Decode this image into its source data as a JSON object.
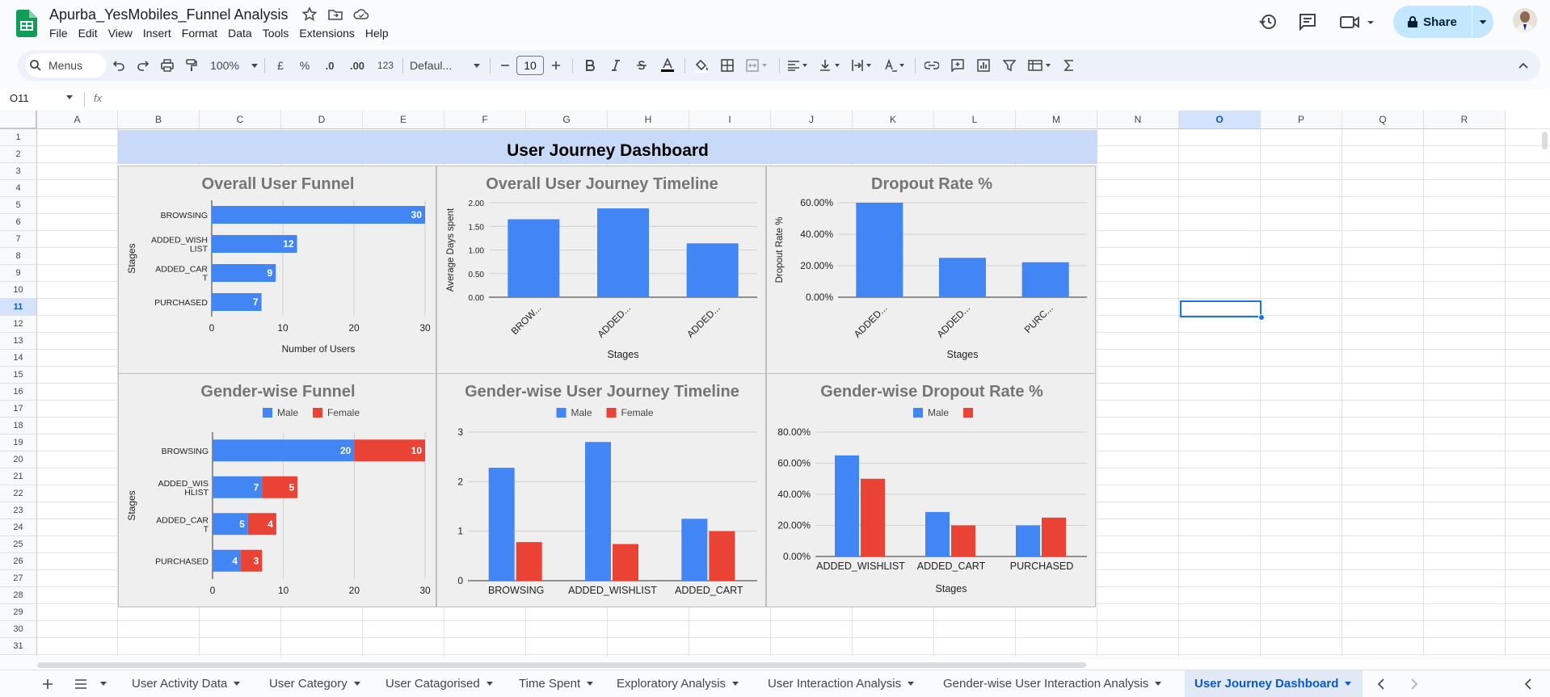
{
  "doc_title": "Apurba_YesMobiles_Funnel Analysis",
  "menu": [
    "File",
    "Edit",
    "View",
    "Insert",
    "Format",
    "Data",
    "Tools",
    "Extensions",
    "Help"
  ],
  "share_label": "Share",
  "toolbar": {
    "search_label": "Menus",
    "zoom": "100%",
    "currency": "£",
    "percent": "%",
    "decrease_decimal": ".0",
    "increase_decimal": ".00",
    "number_format": "123",
    "font": "Defaul...",
    "font_size": "10",
    "accent_color": "#0b57d0"
  },
  "name_box": "O11",
  "fx_label": "fx",
  "columns": [
    "A",
    "B",
    "C",
    "D",
    "E",
    "F",
    "G",
    "H",
    "I",
    "J",
    "K",
    "L",
    "M",
    "N",
    "O",
    "P",
    "Q",
    "R"
  ],
  "rows": [
    "1",
    "2",
    "3",
    "4",
    "5",
    "6",
    "7",
    "8",
    "9",
    "10",
    "11",
    "12",
    "13",
    "14",
    "15",
    "16",
    "17",
    "18",
    "19",
    "20",
    "21",
    "22",
    "23",
    "24",
    "25",
    "26",
    "27",
    "28",
    "29",
    "30",
    "31"
  ],
  "selected_col": "O",
  "selected_row": "11",
  "dashboard_title": "User Journey Dashboard",
  "tabs": [
    "User Activity Data",
    "User Category",
    "User Catagorised",
    "Time Spent",
    "Exploratory Analysis",
    "User Interaction Analysis",
    "Gender-wise User Interaction Analysis",
    "User Journey Dashboard"
  ],
  "active_tab": "User Journey Dashboard",
  "colors": {
    "blue": "#4285f4",
    "red": "#ea4335",
    "title_gray": "#757575",
    "chart_bg": "#efefef",
    "header_band": "#c9daf8"
  },
  "chart_data": [
    {
      "type": "bar",
      "orientation": "horizontal",
      "title": "Overall User Funnel",
      "xlabel": "Number of Users",
      "ylabel": "Stages",
      "categories": [
        "BROWSING",
        "ADDED_WISH LIST",
        "ADDED_CAR T",
        "PURCHASED"
      ],
      "values": [
        30,
        12,
        9,
        7
      ],
      "xticks": [
        "0",
        "10",
        "20",
        "30"
      ],
      "xlim": [
        0,
        30
      ]
    },
    {
      "type": "bar",
      "title": "Overall User Journey Timeline",
      "xlabel": "Stages",
      "ylabel": "Average Days spent",
      "categories": [
        "BROW...",
        "ADDED...",
        "ADDED..."
      ],
      "values": [
        1.65,
        1.88,
        1.14
      ],
      "yticks": [
        "0.00",
        "0.50",
        "1.00",
        "1.50",
        "2.00"
      ],
      "ylim": [
        0,
        2
      ]
    },
    {
      "type": "bar",
      "title": "Dropout Rate %",
      "xlabel": "Stages",
      "ylabel": "Dropout Rate %",
      "categories": [
        "ADDED...",
        "ADDED...",
        "PURC..."
      ],
      "values": [
        60,
        25,
        22.2
      ],
      "yticks": [
        "0.00%",
        "20.00%",
        "40.00%",
        "60.00%"
      ],
      "ylim": [
        0,
        60
      ]
    },
    {
      "type": "bar",
      "orientation": "horizontal",
      "stacked": true,
      "title": "Gender-wise Funnel",
      "ylabel": "Stages",
      "categories": [
        "BROWSING",
        "ADDED_WIS HLIST",
        "ADDED_CAR T",
        "PURCHASED"
      ],
      "series": [
        {
          "name": "Male",
          "values": [
            20,
            7,
            5,
            4
          ]
        },
        {
          "name": "Female",
          "values": [
            10,
            5,
            4,
            3
          ]
        }
      ],
      "xticks": [
        "0",
        "10",
        "20",
        "30"
      ],
      "xlim": [
        0,
        30
      ],
      "legend": "top"
    },
    {
      "type": "bar",
      "title": "Gender-wise User Journey Timeline",
      "categories": [
        "BROWSING",
        "ADDED_WISHLIST",
        "ADDED_CART"
      ],
      "series": [
        {
          "name": "Male",
          "values": [
            2.28,
            2.8,
            1.25
          ]
        },
        {
          "name": "Female",
          "values": [
            0.78,
            0.74,
            1.0
          ]
        }
      ],
      "yticks": [
        "0",
        "1",
        "2",
        "3"
      ],
      "ylim": [
        0,
        3
      ],
      "legend": "top"
    },
    {
      "type": "bar",
      "title": "Gender-wise Dropout Rate %",
      "xlabel": "Stages",
      "categories": [
        "ADDED_WISHLIST",
        "ADDED_CART",
        "PURCHASED"
      ],
      "series": [
        {
          "name": "Male",
          "values": [
            65,
            28.6,
            20
          ]
        },
        {
          "name": "",
          "values": [
            50,
            20,
            25
          ]
        }
      ],
      "yticks": [
        "0.00%",
        "20.00%",
        "40.00%",
        "60.00%",
        "80.00%"
      ],
      "ylim": [
        0,
        80
      ],
      "legend": "top"
    }
  ]
}
